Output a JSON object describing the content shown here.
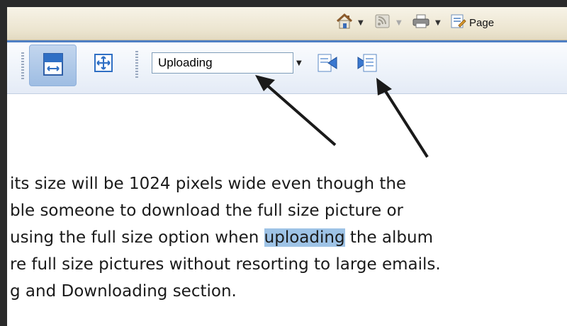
{
  "command_bar": {
    "items": [
      {
        "icon": "home-icon"
      },
      {
        "icon": "feeds-icon"
      },
      {
        "icon": "print-icon"
      },
      {
        "icon": "page-icon",
        "label": "Page"
      }
    ]
  },
  "toolbar": {
    "buttons": [
      {
        "icon": "fit-width-icon",
        "active": true
      },
      {
        "icon": "fit-page-icon",
        "active": false
      }
    ],
    "search": {
      "value": "Uploading"
    },
    "find_previous_icon": "find-previous-icon",
    "find_next_icon": "find-next-icon"
  },
  "document": {
    "lines": [
      {
        "text": "its size will be 1024 pixels wide even though the"
      },
      {
        "text": "ble someone to download the full size picture or"
      },
      {
        "before": "using the full size option when ",
        "highlight": "uploading",
        "after": " the album"
      },
      {
        "text": "re full size pictures without resorting to large emails."
      },
      {
        "text": "g and Downloading section."
      }
    ]
  }
}
